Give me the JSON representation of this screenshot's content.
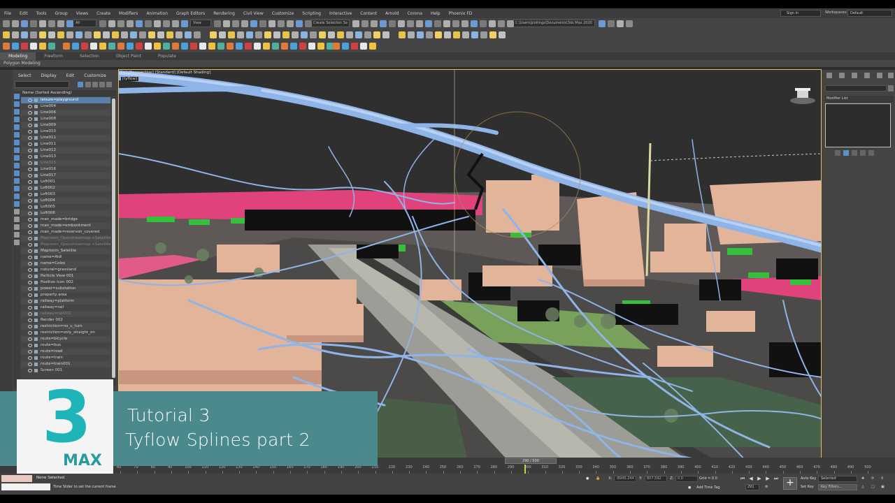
{
  "menu": {
    "items": [
      "File",
      "Edit",
      "Tools",
      "Group",
      "Views",
      "Create",
      "Modifiers",
      "Animation",
      "Graph Editors",
      "Rendering",
      "Civil View",
      "Customize",
      "Scripting",
      "Interactive",
      "Content",
      "Arnold",
      "Corona",
      "Help",
      "Phoenix FD"
    ],
    "sign_in": "Sign In",
    "workspaces_label": "Workspaces:",
    "workspaces_value": "Default"
  },
  "toolbar": {
    "filter_value": "All",
    "view_value": "View",
    "selection_set": "Create Selection Se",
    "project_path": "C:\\Users\\jcollings\\Documents\\3ds Max 2020"
  },
  "ribbon": {
    "tabs": [
      "Modeling",
      "Freeform",
      "Selection",
      "Object Paint",
      "Populate"
    ],
    "active_tab": "Modeling",
    "sub_label": "Polygon Modeling"
  },
  "explorer": {
    "menu": [
      "Select",
      "Display",
      "Edit",
      "Customize"
    ],
    "header": "Name (Sorted Ascending)",
    "rows": [
      {
        "name": "leisure=playground",
        "state": "sel"
      },
      {
        "name": "Line004",
        "state": ""
      },
      {
        "name": "Line006",
        "state": ""
      },
      {
        "name": "Line008",
        "state": ""
      },
      {
        "name": "Line009",
        "state": ""
      },
      {
        "name": "Line010",
        "state": ""
      },
      {
        "name": "Line011",
        "state": ""
      },
      {
        "name": "Line011",
        "state": ""
      },
      {
        "name": "Line012",
        "state": ""
      },
      {
        "name": "Line013",
        "state": ""
      },
      {
        "name": "Line015",
        "state": "dim"
      },
      {
        "name": "Line016",
        "state": ""
      },
      {
        "name": "Line017",
        "state": ""
      },
      {
        "name": "Loft001",
        "state": ""
      },
      {
        "name": "Loft002",
        "state": ""
      },
      {
        "name": "Loft003",
        "state": ""
      },
      {
        "name": "Loft004",
        "state": ""
      },
      {
        "name": "Loft005",
        "state": ""
      },
      {
        "name": "Loft006",
        "state": ""
      },
      {
        "name": "man_made=bridge",
        "state": ""
      },
      {
        "name": "man_made=embankment",
        "state": ""
      },
      {
        "name": "man_made=reservoir_covered",
        "state": ""
      },
      {
        "name": "Maproom_Openstreetmap +Satellite",
        "state": "dim"
      },
      {
        "name": "Maproom_Openstreetmap +Satellite",
        "state": "dim"
      },
      {
        "name": "Maproom_Satellite",
        "state": ""
      },
      {
        "name": "name=Aldi",
        "state": ""
      },
      {
        "name": "name=Coles",
        "state": ""
      },
      {
        "name": "natural=grassland",
        "state": ""
      },
      {
        "name": "Particle View 001",
        "state": ""
      },
      {
        "name": "Position Icon 002",
        "state": ""
      },
      {
        "name": "power=substation",
        "state": ""
      },
      {
        "name": "property area",
        "state": ""
      },
      {
        "name": "railway=platform",
        "state": ""
      },
      {
        "name": "railway=rail",
        "state": ""
      },
      {
        "name": "railway=rail001",
        "state": "dim"
      },
      {
        "name": "Render 002",
        "state": ""
      },
      {
        "name": "restriction=no_u_turn",
        "state": ""
      },
      {
        "name": "restriction=only_straight_on",
        "state": ""
      },
      {
        "name": "route=bicycle",
        "state": ""
      },
      {
        "name": "route=bus",
        "state": ""
      },
      {
        "name": "route=road",
        "state": ""
      },
      {
        "name": "route=train",
        "state": ""
      },
      {
        "name": "route=train001",
        "state": ""
      },
      {
        "name": "Screen 001",
        "state": ""
      }
    ]
  },
  "viewport": {
    "label": "[+] [Perspective] [Standard] [Default Shading]",
    "sub_label": "[tyflow]"
  },
  "command_panel": {
    "modifier_list": "Modifier List"
  },
  "timeline": {
    "slider_text": "290 / 500",
    "ticks": [
      "60",
      "70",
      "80",
      "90",
      "100",
      "110",
      "120",
      "130",
      "140",
      "150",
      "160",
      "170",
      "180",
      "190",
      "200",
      "210",
      "220",
      "230",
      "240",
      "250",
      "260",
      "270",
      "280",
      "290",
      "300",
      "310",
      "320",
      "330",
      "340",
      "350",
      "360",
      "370",
      "380",
      "390",
      "400",
      "410",
      "420",
      "430",
      "440",
      "450",
      "460",
      "470",
      "480",
      "490",
      "500"
    ]
  },
  "status": {
    "selection": "None Selected",
    "prompt": "Time Slider to set the current frame",
    "x_label": "X:",
    "x_value": "-8945.244",
    "y_label": "Y:",
    "y_value": "807.592",
    "z_label": "Z:",
    "z_value": "0.0",
    "grid": "Grid = 0.0",
    "add_time_tag": "Add Time Tag",
    "frame": "291",
    "auto_key": "Auto Key",
    "set_key": "Set Key",
    "selected": "Selected",
    "key_filters": "Key Filters..."
  },
  "overlay": {
    "line1": "Tutorial 3",
    "line2": "Tyflow Splines part 2",
    "logo_number": "3",
    "logo_text": "MAX"
  },
  "colors": {
    "accent_teal": "#4a8a8c",
    "logo_teal": "#1fb5b8",
    "spline_blue": "#8fb4e8",
    "building": "#e2b49a",
    "pink_area": "#e0437c",
    "green": "#3fc23f"
  }
}
